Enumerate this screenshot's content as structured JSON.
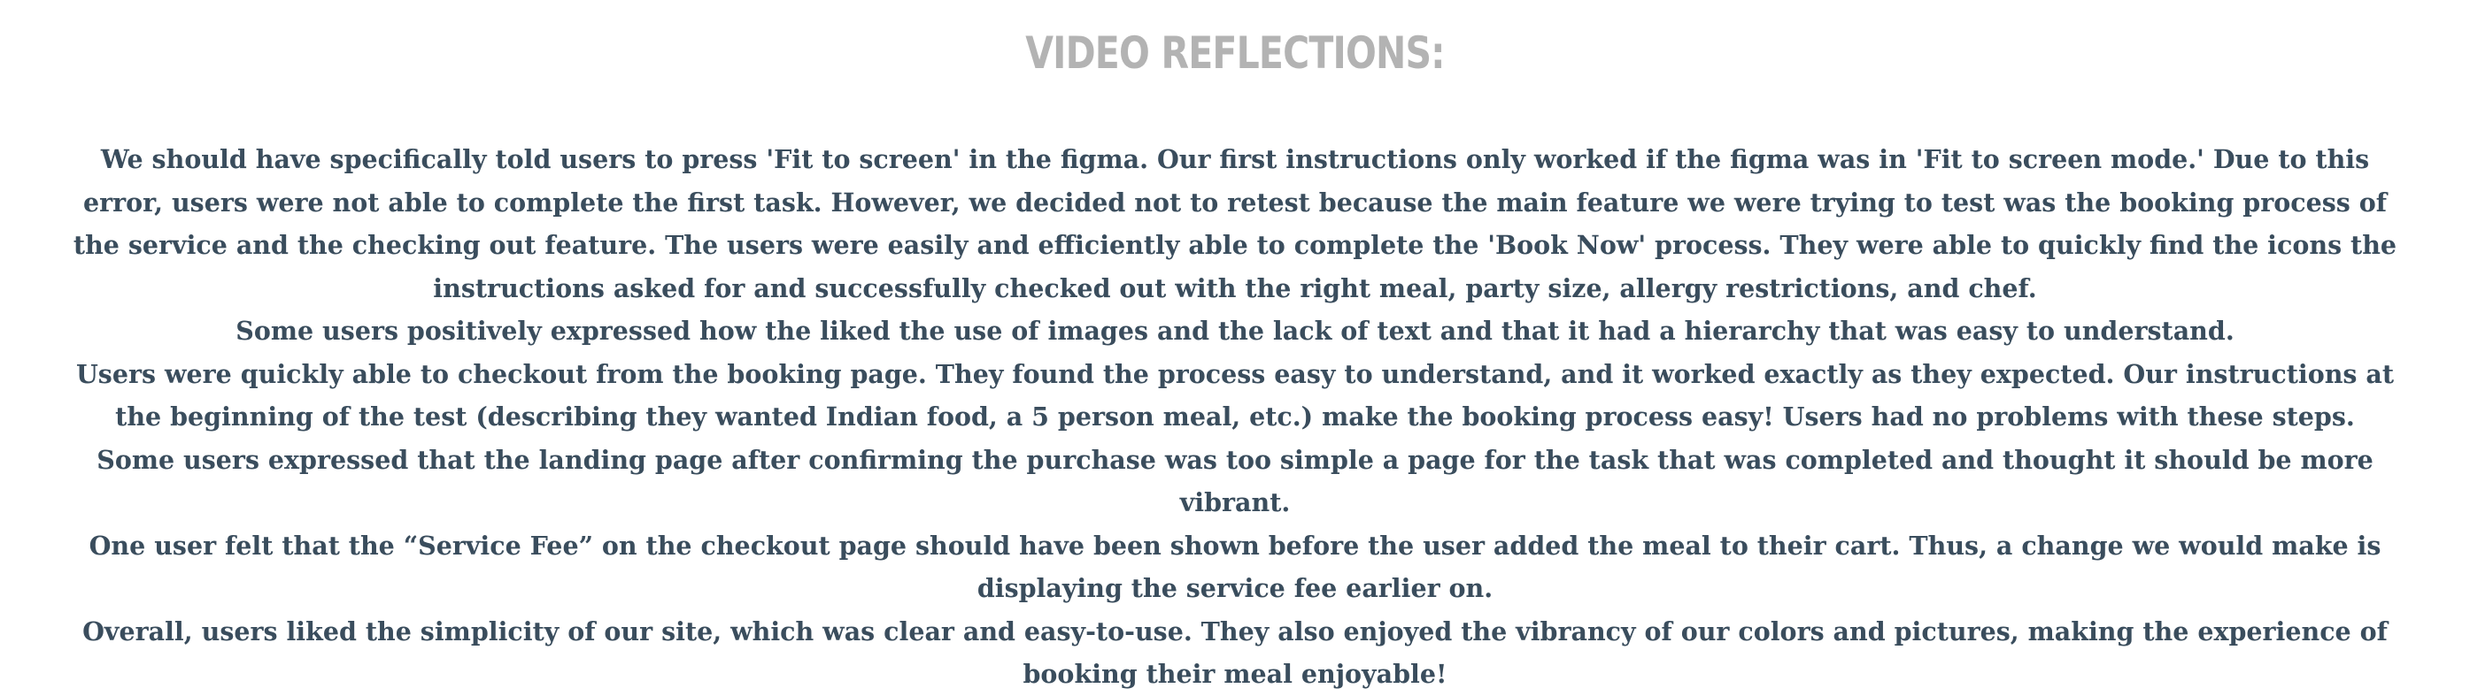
{
  "title": "VIDEO REFLECTIONS:",
  "paragraphs": [
    "We should have specifically told users to press 'Fit to screen' in the figma. Our first instructions only worked if the figma was in 'Fit to screen mode.' Due to this error, users were not able to complete the first task. However, we decided not to retest because the main feature we were trying to test was the booking process of the service and the checking out feature. The users were easily and efficiently able to complete the 'Book Now' process. They were able to quickly find the icons the instructions asked for and successfully checked out with the right meal, party size, allergy restrictions, and chef.",
    "Some users positively expressed how the liked the use of images and the lack of text and that it had a hierarchy that was easy to understand.",
    "Users were quickly able to checkout from the booking page. They found the process easy to understand, and it worked exactly as they expected. Our instructions at the beginning of the test (describing they wanted Indian food, a 5 person meal, etc.) make the booking process easy! Users had no problems with these steps.",
    "Some users expressed that the landing page after confirming the purchase was too simple a page for the task that was completed and thought it should be more vibrant.",
    "One user felt that the “Service Fee” on the checkout page should have been shown before the user added the meal to their cart. Thus, a change we would make is displaying the service fee earlier on.",
    "Overall, users liked the simplicity of our site, which was clear and easy-to-use. They also enjoyed the vibrancy of our colors and pictures, making the experience of booking their meal enjoyable!"
  ],
  "colors": {
    "title": "#b3b3b3",
    "text": "#3a4d5d",
    "background": "#ffffff"
  }
}
